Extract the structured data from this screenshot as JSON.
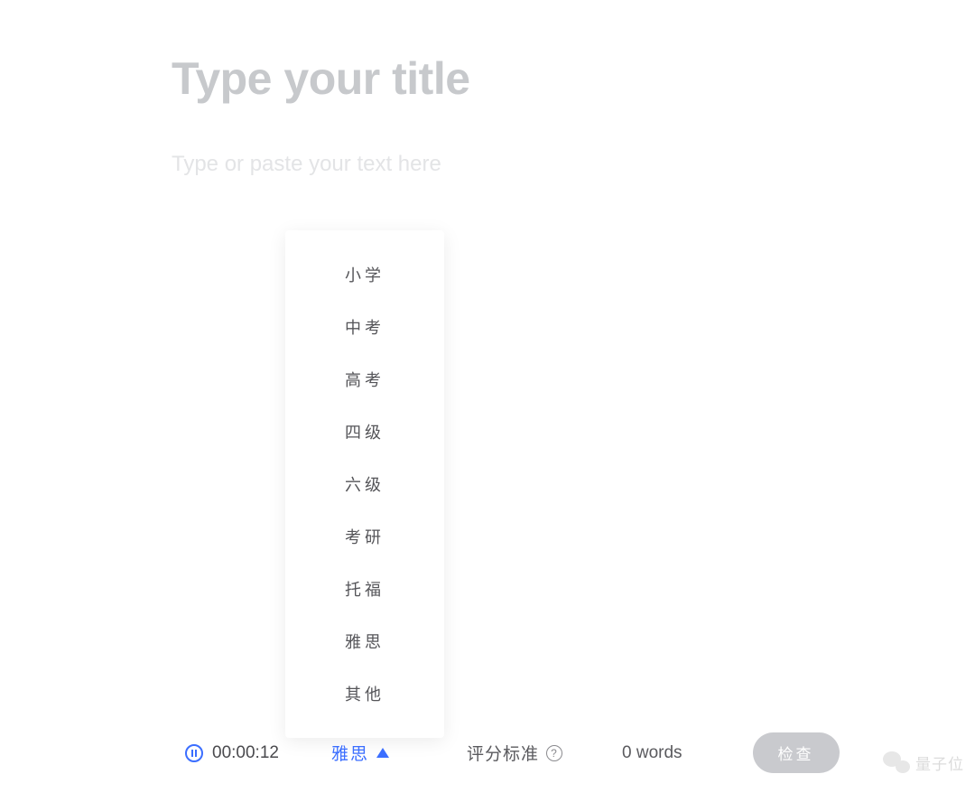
{
  "editor": {
    "title_placeholder": "Type your title",
    "body_placeholder": "Type or paste your text here"
  },
  "dropdown": {
    "items": [
      "小学",
      "中考",
      "高考",
      "四级",
      "六级",
      "考研",
      "托福",
      "雅思",
      "其他"
    ]
  },
  "bottom_bar": {
    "timer": "00:00:12",
    "selected_level": "雅思",
    "criteria_label": "评分标准",
    "word_count": "0 words",
    "check_button": "检查"
  },
  "watermark": {
    "text": "量子位"
  }
}
